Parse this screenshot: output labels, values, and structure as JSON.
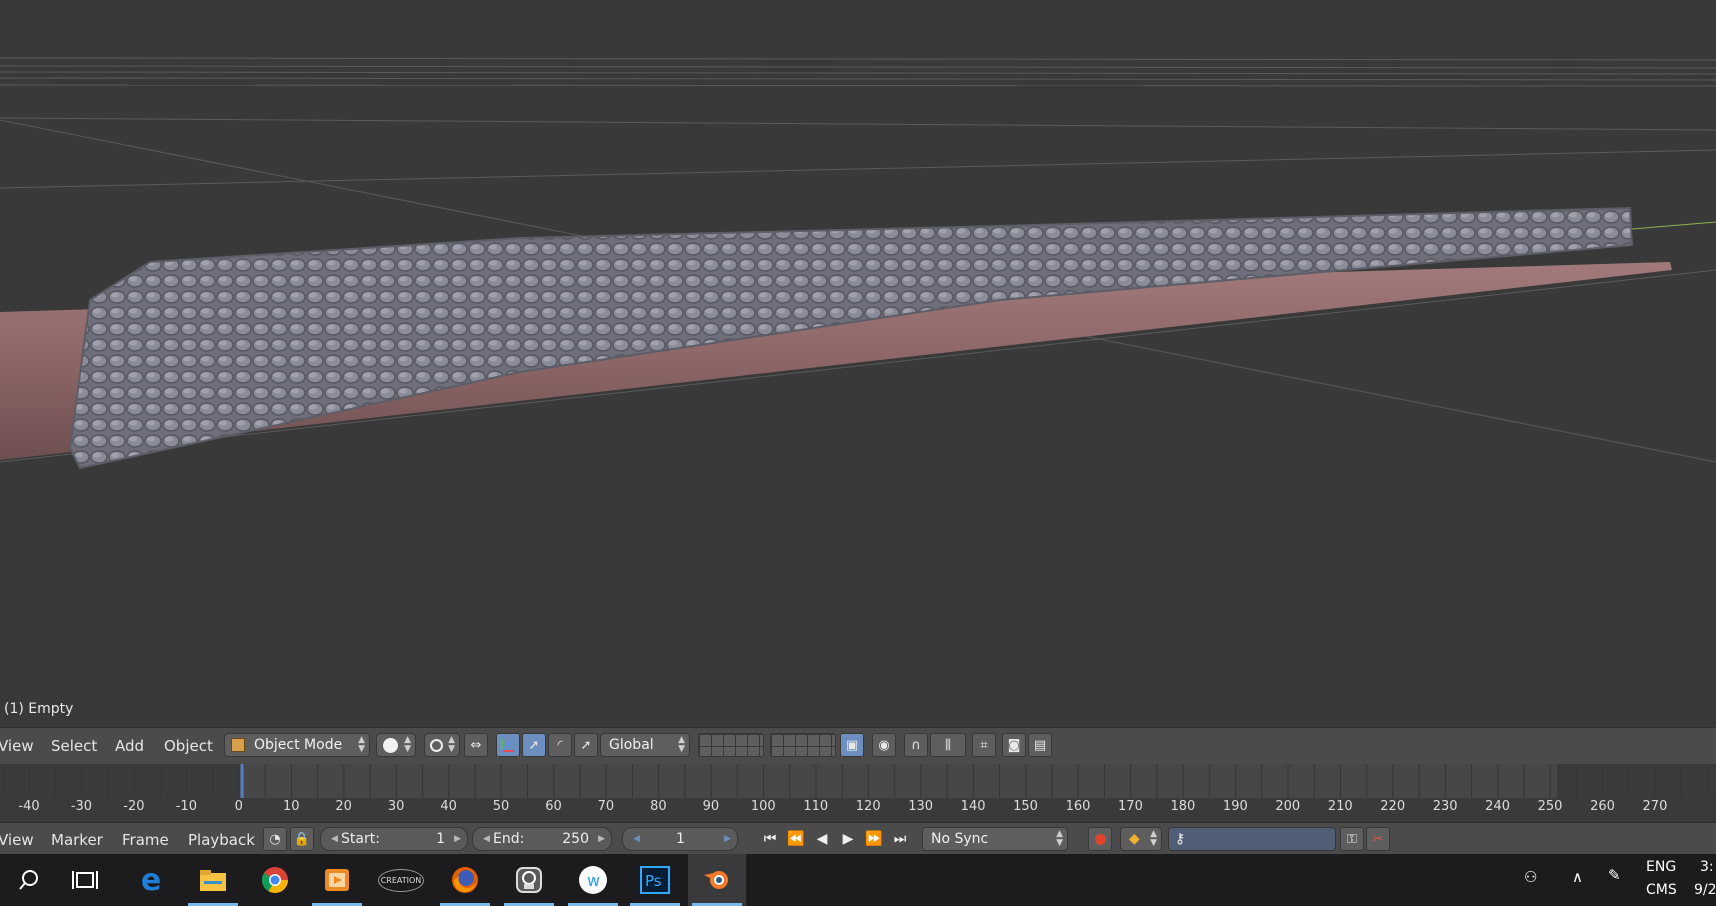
{
  "viewport": {
    "object_label": "(1) Empty"
  },
  "header_3d": {
    "menus": [
      "View",
      "Select",
      "Add",
      "Object"
    ],
    "mode": "Object Mode",
    "orientation": "Global"
  },
  "timeline": {
    "ticks": [
      "-40",
      "-30",
      "-20",
      "-10",
      "0",
      "10",
      "20",
      "30",
      "40",
      "50",
      "60",
      "70",
      "80",
      "90",
      "100",
      "110",
      "120",
      "130",
      "140",
      "150",
      "160",
      "170",
      "180",
      "190",
      "200",
      "210",
      "220",
      "230",
      "240",
      "250",
      "260",
      "270"
    ]
  },
  "header_timeline": {
    "menus": [
      "View",
      "Marker",
      "Frame",
      "Playback"
    ],
    "start_label": "Start:",
    "start_value": "1",
    "end_label": "End:",
    "end_value": "250",
    "current_frame": "1",
    "sync": "No Sync"
  },
  "taskbar": {
    "apps": [
      "search-icon",
      "task-view-icon",
      "edge-icon",
      "file-explorer-icon",
      "chrome-icon",
      "media-player-icon",
      "creation-kit-icon",
      "firefox-icon",
      "app-icon",
      "word-icon",
      "photoshop-icon",
      "blender-icon"
    ],
    "lang_top": "ENG",
    "lang_bottom": "CMS",
    "time_partial": "3:",
    "date_partial": "9/2"
  }
}
